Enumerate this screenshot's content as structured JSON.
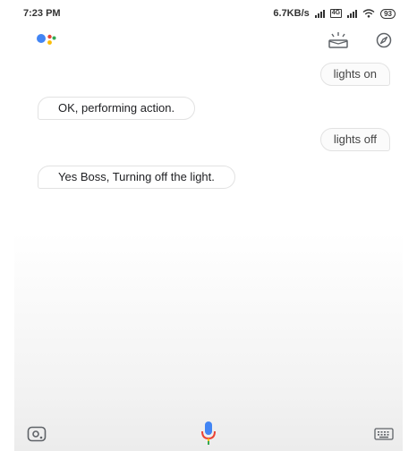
{
  "status_bar": {
    "time": "7:23 PM",
    "net_speed": "6.7KB/s",
    "network_badge": "4G",
    "battery": "93"
  },
  "header": {
    "logo_icon": "google-assistant-logo",
    "left_action_icon": "snapshot-icon",
    "right_action_icon": "explore-compass-icon"
  },
  "conversation": [
    {
      "role": "user",
      "text": "lights on"
    },
    {
      "role": "assistant",
      "text": "OK, performing action."
    },
    {
      "role": "user",
      "text": "lights off"
    },
    {
      "role": "assistant",
      "text": "Yes Boss, Turning off the light."
    }
  ],
  "bottom_bar": {
    "left_icon": "lens-icon",
    "center_icon": "mic-icon",
    "right_icon": "keyboard-icon"
  },
  "colors": {
    "google_blue": "#4285F4",
    "google_red": "#EA4335",
    "google_yellow": "#FBBC05",
    "google_green": "#34A853"
  }
}
